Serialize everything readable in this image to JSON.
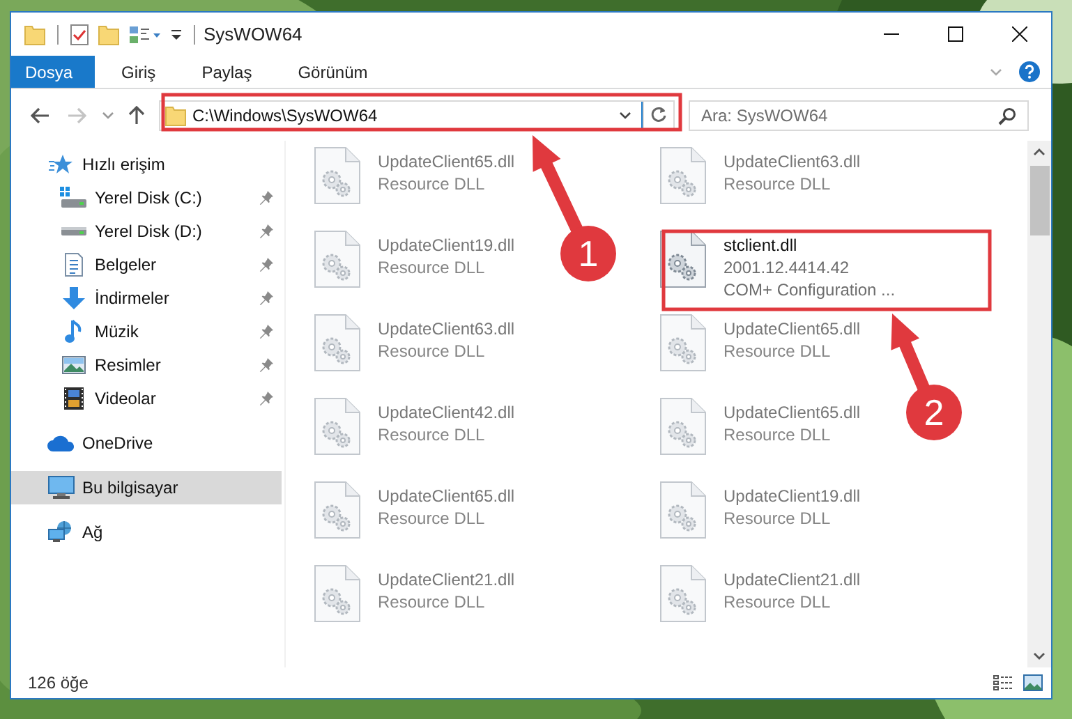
{
  "window": {
    "title": "SysWOW64"
  },
  "ribbon": {
    "tabs": [
      {
        "label": "Dosya",
        "selected": true
      },
      {
        "label": "Giriş",
        "selected": false
      },
      {
        "label": "Paylaş",
        "selected": false
      },
      {
        "label": "Görünüm",
        "selected": false
      }
    ]
  },
  "address_bar": {
    "path": "C:\\Windows\\SysWOW64"
  },
  "search": {
    "placeholder": "Ara: SysWOW64"
  },
  "sidebar": {
    "items": [
      {
        "label": "Hızlı erişim",
        "kind": "star",
        "selected": false,
        "children": [
          {
            "label": "Yerel Disk (C:)",
            "kind": "system-drive",
            "pinned": true,
            "selected": false
          },
          {
            "label": "Yerel Disk (D:)",
            "kind": "drive",
            "pinned": true,
            "selected": false
          },
          {
            "label": "Belgeler",
            "kind": "documents",
            "pinned": true,
            "selected": false
          },
          {
            "label": "İndirmeler",
            "kind": "downloads",
            "pinned": true,
            "selected": false
          },
          {
            "label": "Müzik",
            "kind": "music",
            "pinned": true,
            "selected": false
          },
          {
            "label": "Resimler",
            "kind": "pictures",
            "pinned": true,
            "selected": false
          },
          {
            "label": "Videolar",
            "kind": "videos",
            "pinned": true,
            "selected": false
          }
        ]
      },
      {
        "label": "OneDrive",
        "kind": "cloud",
        "selected": false
      },
      {
        "label": "Bu bilgisayar",
        "kind": "computer",
        "selected": true
      },
      {
        "label": "Ağ",
        "kind": "network",
        "selected": false
      }
    ]
  },
  "files": [
    {
      "name": "UpdateClient65.dll",
      "details": [
        "Resource DLL"
      ],
      "blurred": true
    },
    {
      "name": "UpdateClient63.dll",
      "details": [
        "Resource DLL"
      ],
      "blurred": true
    },
    {
      "name": "UpdateClient19.dll",
      "details": [
        "Resource DLL"
      ],
      "blurred": true
    },
    {
      "name": "stclient.dll",
      "details": [
        "2001.12.4414.42",
        "COM+ Configuration ..."
      ],
      "blurred": false
    },
    {
      "name": "UpdateClient63.dll",
      "details": [
        "Resource DLL"
      ],
      "blurred": true
    },
    {
      "name": "UpdateClient65.dll",
      "details": [
        "Resource DLL"
      ],
      "blurred": true
    },
    {
      "name": "UpdateClient42.dll",
      "details": [
        "Resource DLL"
      ],
      "blurred": true
    },
    {
      "name": "UpdateClient65.dll",
      "details": [
        "Resource DLL"
      ],
      "blurred": true
    },
    {
      "name": "UpdateClient65.dll",
      "details": [
        "Resource DLL"
      ],
      "blurred": true
    },
    {
      "name": "UpdateClient19.dll",
      "details": [
        "Resource DLL"
      ],
      "blurred": true
    },
    {
      "name": "UpdateClient21.dll",
      "details": [
        "Resource DLL"
      ],
      "blurred": true
    },
    {
      "name": "UpdateClient21.dll",
      "details": [
        "Resource DLL"
      ],
      "blurred": true
    }
  ],
  "status_bar": {
    "item_count": "126 öğe"
  },
  "annotations": [
    {
      "label": "1"
    },
    {
      "label": "2"
    }
  ]
}
